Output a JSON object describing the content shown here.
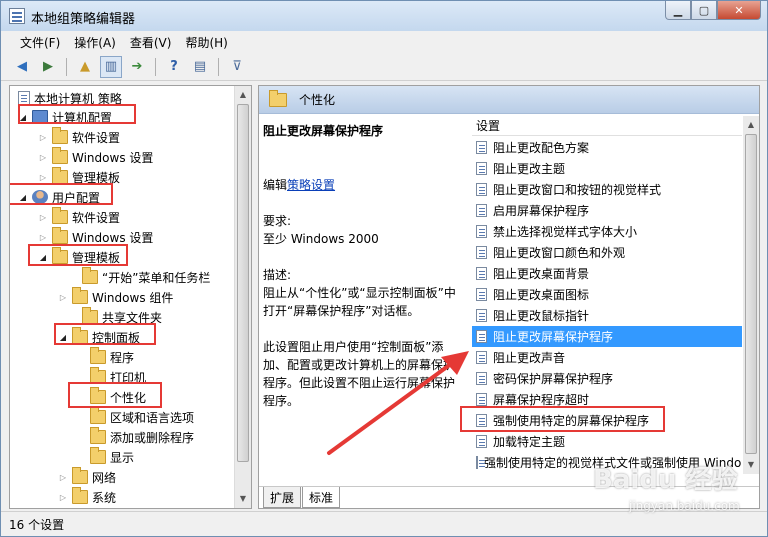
{
  "window": {
    "title": "本地组策略编辑器"
  },
  "menu": [
    "文件(F)",
    "操作(A)",
    "查看(V)",
    "帮助(H)"
  ],
  "tree": {
    "root": "本地计算机 策略",
    "items": [
      {
        "label": "计算机配置",
        "icon": "computer-icon",
        "level": 1
      },
      {
        "label": "软件设置",
        "icon": "folder-icon",
        "level": 2
      },
      {
        "label": "Windows 设置",
        "icon": "folder-icon",
        "level": 2
      },
      {
        "label": "管理模板",
        "icon": "folder-icon",
        "level": 2
      },
      {
        "label": "用户配置",
        "icon": "user-icon",
        "level": 1
      },
      {
        "label": "软件设置",
        "icon": "folder-icon",
        "level": 2
      },
      {
        "label": "Windows 设置",
        "icon": "folder-icon",
        "level": 2
      },
      {
        "label": "管理模板",
        "icon": "folder-icon",
        "level": 2
      },
      {
        "label": "“开始”菜单和任务栏",
        "icon": "folder-icon",
        "level": 3
      },
      {
        "label": "Windows 组件",
        "icon": "folder-icon",
        "level": 3
      },
      {
        "label": "共享文件夹",
        "icon": "folder-icon",
        "level": 3
      },
      {
        "label": "控制面板",
        "icon": "folder-icon",
        "level": 3
      },
      {
        "label": "程序",
        "icon": "folder-icon",
        "level": 4
      },
      {
        "label": "打印机",
        "icon": "folder-icon",
        "level": 4
      },
      {
        "label": "个性化",
        "icon": "folder-icon",
        "level": 4
      },
      {
        "label": "区域和语言选项",
        "icon": "folder-icon",
        "level": 4
      },
      {
        "label": "添加或删除程序",
        "icon": "folder-icon",
        "level": 4
      },
      {
        "label": "显示",
        "icon": "folder-icon",
        "level": 4
      },
      {
        "label": "网络",
        "icon": "folder-icon",
        "level": 3
      },
      {
        "label": "系统",
        "icon": "folder-icon",
        "level": 3
      }
    ]
  },
  "right": {
    "header": "个性化",
    "description": {
      "title": "阻止更改屏幕保护程序",
      "edit_prefix": "编辑",
      "edit_link": "策略设置",
      "req_label": "要求:",
      "req_value": "至少 Windows 2000",
      "desc_label": "描述:",
      "desc_text1": "阻止从“个性化”或“显示控制面板”中打开“屏幕保护程序”对话框。",
      "desc_text2": "此设置阻止用户使用“控制面板”添加、配置或更改计算机上的屏幕保护程序。但此设置不阻止运行屏幕保护程序。"
    },
    "list_header": "设置",
    "list": [
      "阻止更改配色方案",
      "阻止更改主题",
      "阻止更改窗口和按钮的视觉样式",
      "启用屏幕保护程序",
      "禁止选择视觉样式字体大小",
      "阻止更改窗口颜色和外观",
      "阻止更改桌面背景",
      "阻止更改桌面图标",
      "阻止更改鼠标指针",
      "阻止更改屏幕保护程序",
      "阻止更改声音",
      "密码保护屏幕保护程序",
      "屏幕保护程序超时",
      "强制使用特定的屏幕保护程序",
      "加载特定主题",
      "强制使用特定的视觉样式文件或强制使用 Windows 经典"
    ],
    "selected_index": 9,
    "tabs": [
      "扩展",
      "标准"
    ]
  },
  "status": "16 个设置",
  "watermark": {
    "big": "Baidu 经验",
    "small": "jingyan.baidu.com"
  },
  "colors": {
    "selection": "#3399ff",
    "highlight": "#e53935",
    "link": "#0a3fb8"
  }
}
